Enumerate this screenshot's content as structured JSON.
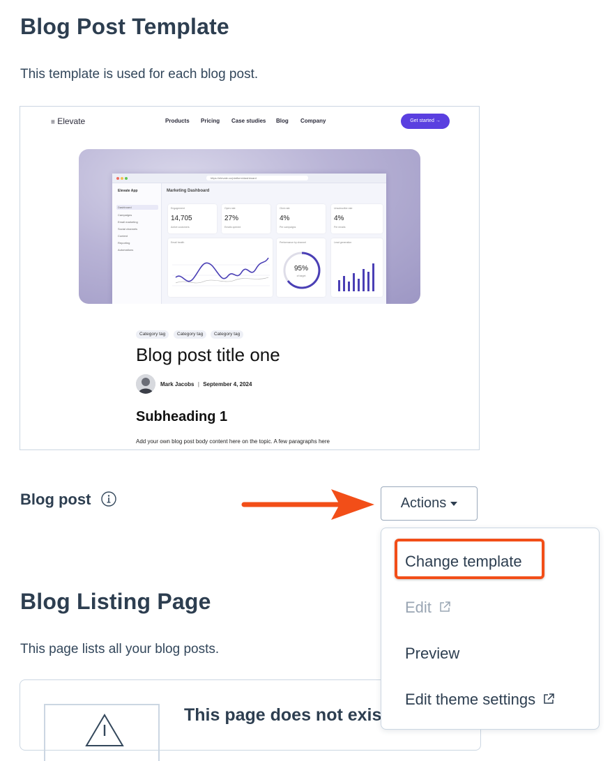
{
  "template_section": {
    "title": "Blog Post Template",
    "description": "This template is used for each blog post."
  },
  "preview": {
    "logo": "Elevate",
    "nav": [
      "Products",
      "Pricing",
      "Case studies",
      "Blog",
      "Company"
    ],
    "cta": "Get started",
    "dashboard": {
      "app_name": "Elevate App",
      "title": "Marketing Dashboard",
      "url": "https://elevate.co/platform/dashboard",
      "sidebar": [
        "Dashboard",
        "Campaigns",
        "Email marketing",
        "Social channels",
        "Content",
        "Reporting",
        "Automations"
      ],
      "cards": [
        {
          "label": "Engagement",
          "value": "14,705",
          "sub": "Active customers"
        },
        {
          "label": "Open rate",
          "value": "27%",
          "sub": "Emails opened"
        },
        {
          "label": "Click rate",
          "value": "4%",
          "sub": "Per campaigns"
        },
        {
          "label": "Unsubscribe rate",
          "value": "4%",
          "sub": "Per emails"
        }
      ],
      "panels": [
        "Email health",
        "Performance by channel",
        "Lead generation"
      ],
      "gauge_value": "95%",
      "gauge_label": "of target"
    },
    "tags": [
      "Category tag",
      "Category tag",
      "Category tag"
    ],
    "post_title": "Blog post title one",
    "author": "Mark Jacobs",
    "date": "September 4, 2024",
    "subheading": "Subheading 1",
    "body": "Add your own blog post body content here on the topic. A few paragraphs here"
  },
  "blog_post_label": "Blog post",
  "actions_button": "Actions",
  "menu": {
    "items": [
      {
        "label": "Change template",
        "disabled": false,
        "external": false
      },
      {
        "label": "Edit",
        "disabled": true,
        "external": true
      },
      {
        "label": "Preview",
        "disabled": false,
        "external": false
      },
      {
        "label": "Edit theme settings",
        "disabled": false,
        "external": true
      }
    ]
  },
  "listing_section": {
    "title": "Blog Listing Page",
    "description": "This page lists all your blog posts.",
    "empty_message": "This page does not exist"
  },
  "colors": {
    "accent": "#f24e18",
    "heading": "#2d3e50",
    "border": "#cbd6e2",
    "cta": "#5a3fe0"
  },
  "icons": [
    "info-icon",
    "external-link-icon",
    "arrow-icon",
    "caret-down-icon",
    "warning-icon"
  ]
}
